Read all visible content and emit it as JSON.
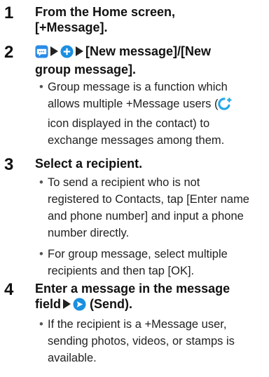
{
  "steps": [
    {
      "number": "1",
      "title_line1": "From the Home screen,",
      "title_line2": "[+Message]."
    },
    {
      "number": "2",
      "title_line1_text": "[New message]/[New",
      "title_line2": "group message].",
      "title_icons": [
        "message-app-icon",
        "add-circle-icon"
      ],
      "bullet": {
        "line1": "Group message is a function which",
        "line2_before_icon": "allows multiple +Message users (",
        "line3": "icon displayed in the contact) to",
        "line4": "exchange messages among them.",
        "icon": "plus-message-user-icon"
      }
    },
    {
      "number": "3",
      "title": "Select a recipient.",
      "bullets": [
        [
          "To send a recipient who is not",
          "registered to Contacts, tap [Enter name",
          "and phone number] and input a phone",
          "number directly."
        ],
        [
          "For group message, select multiple",
          "recipients and then tap [OK]."
        ]
      ]
    },
    {
      "number": "4",
      "title_line1": "Enter a message in the message",
      "title_line2_before": "field",
      "title_line2_after": "(Send).",
      "title_icon": "send-icon",
      "bullet": [
        "If the recipient is a +Message user,",
        "sending photos, videos, or stamps is",
        "available."
      ]
    }
  ],
  "colors": {
    "accent_blue": "#1a8fe0",
    "accent_cyan": "#22a6e8",
    "text": "#1a1a1a"
  }
}
